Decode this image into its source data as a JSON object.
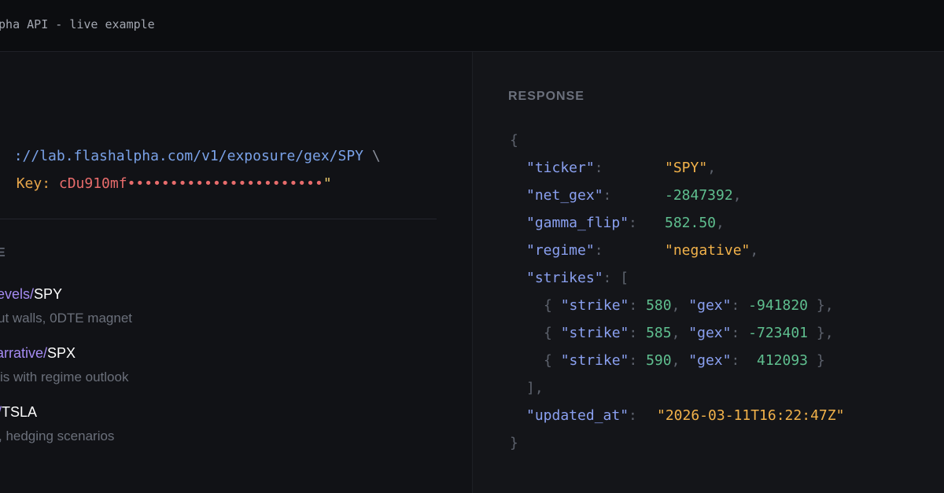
{
  "header": {
    "title": "lpha API - live example"
  },
  "request": {
    "url_line": "://lab.flashalpha.com/v1/exposure/gex/SPY",
    "backslash": "\\",
    "header_key": "Key: ",
    "header_value": "cDu910mf•••••••••••••••••••••••",
    "header_quote": "\""
  },
  "examples": {
    "section_label": "E",
    "items": [
      {
        "prefix": "evels/",
        "ticker": "SPY",
        "desc": "ut walls, 0DTE magnet"
      },
      {
        "prefix": "arrative/",
        "ticker": "SPX",
        "desc": "is with regime outlook"
      },
      {
        "prefix": "/",
        "ticker": "TSLA",
        "desc": ", hedging scenarios"
      }
    ]
  },
  "response": {
    "label": "RESPONSE",
    "open_brace": "{",
    "close_brace": "}",
    "fields": {
      "ticker_key": "\"ticker\"",
      "ticker_val": "\"SPY\"",
      "net_gex_key": "\"net_gex\"",
      "net_gex_val": "-2847392",
      "gamma_flip_key": "\"gamma_flip\"",
      "gamma_flip_val": "582.50",
      "regime_key": "\"regime\"",
      "regime_val": "\"negative\"",
      "strikes_key": "\"strikes\"",
      "updated_at_key": "\"updated_at\"",
      "updated_at_val": "\"2026-03-11T16:22:47Z\""
    },
    "strikes": [
      {
        "strike_key": "\"strike\"",
        "strike": "580",
        "gex_key": "\"gex\"",
        "gex": "-941820"
      },
      {
        "strike_key": "\"strike\"",
        "strike": "585",
        "gex_key": "\"gex\"",
        "gex": "-723401"
      },
      {
        "strike_key": "\"strike\"",
        "strike": "590",
        "gex_key": "\"gex\"",
        "gex": " 412093"
      }
    ]
  }
}
